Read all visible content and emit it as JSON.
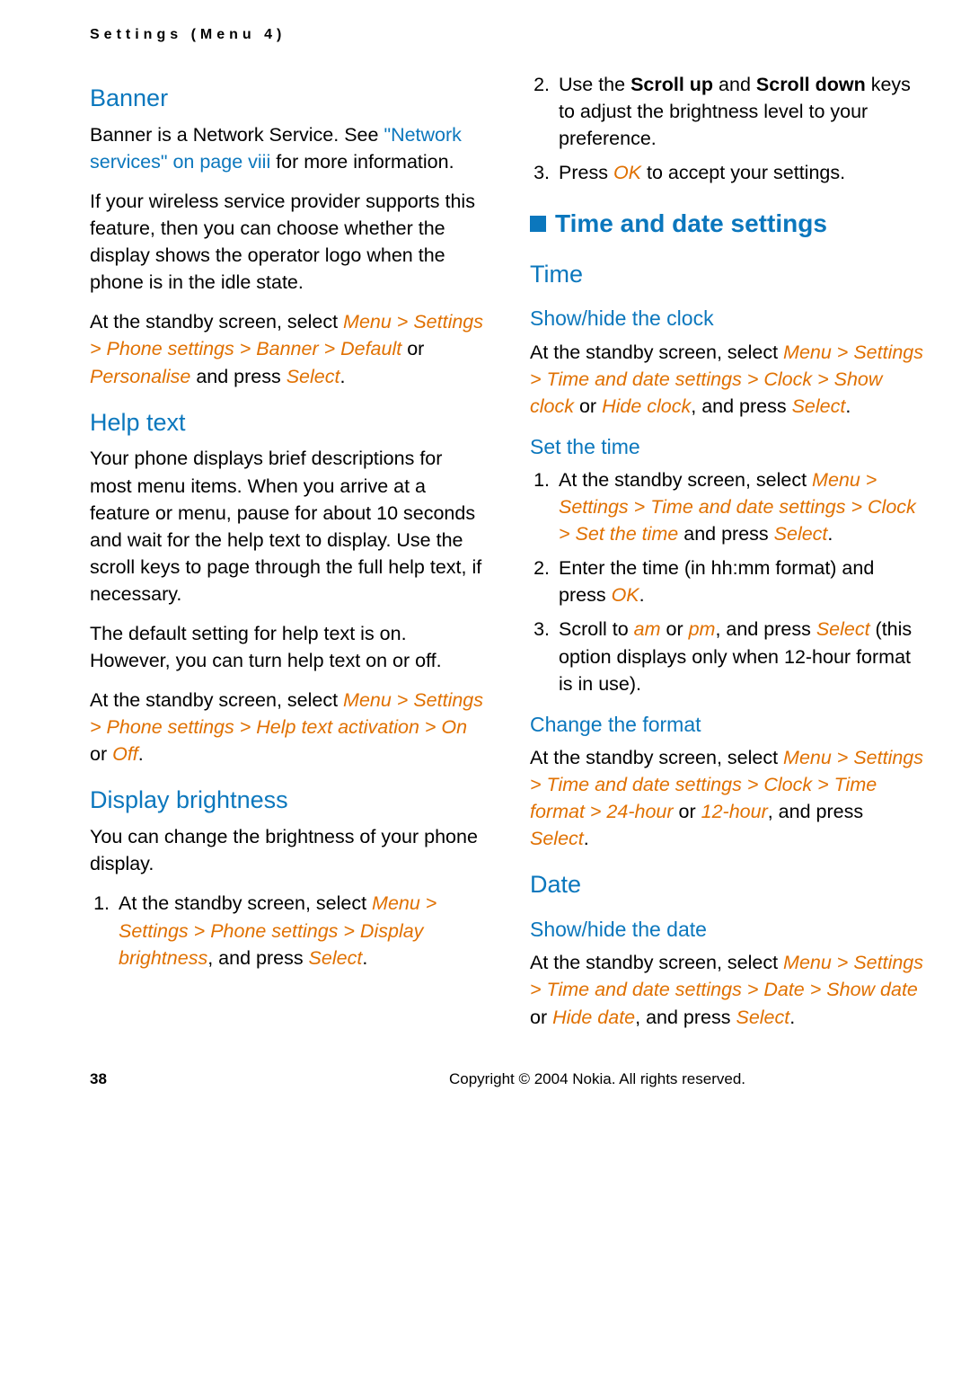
{
  "header": "Settings (Menu 4)",
  "left": {
    "banner": {
      "title": "Banner",
      "p1_a": "Banner is a Network Service. See ",
      "p1_link": "\"Network services\" on page viii",
      "p1_b": " for more information.",
      "p2": "If your wireless service provider supports this feature, then you can choose whether the display shows the operator logo when the phone is in the idle state.",
      "p3_a": "At the standby screen, select ",
      "p3_path": "Menu > Settings > Phone settings > Banner > Default",
      "p3_or": " or ",
      "p3_path2": "Personalise",
      "p3_b": " and press ",
      "p3_sel": "Select",
      "p3_dot": "."
    },
    "help": {
      "title": "Help text",
      "p1": "Your phone displays brief descriptions for most menu items. When you arrive at a feature or menu, pause for about 10 seconds and wait for the help text to display. Use the scroll keys to page through the full help text, if necessary.",
      "p2": "The default setting for help text is on. However, you can turn help text on or off.",
      "p3_a": "At the standby screen, select ",
      "p3_path": "Menu > Settings > Phone settings > Help text activation > On",
      "p3_or": " or ",
      "p3_off": "Off",
      "p3_dot": "."
    },
    "bright": {
      "title": "Display brightness",
      "p1": "You can change the brightness of your phone display.",
      "s1_a": "At the standby screen, select ",
      "s1_path": "Menu > Settings > Phone settings > Display brightness",
      "s1_b": ", and press ",
      "s1_sel": "Select",
      "s1_dot": "."
    }
  },
  "right": {
    "bright_cont": {
      "s2_a": "Use the ",
      "s2_su": "Scroll up",
      "s2_and": " and ",
      "s2_sd": "Scroll down",
      "s2_b": " keys to adjust the brightness level to your preference.",
      "s3_a": "Press ",
      "s3_ok": "OK",
      "s3_b": " to accept your settings."
    },
    "section": "Time and date settings",
    "time": {
      "title": "Time",
      "showhide": {
        "title": "Show/hide the clock",
        "a": "At the standby screen, select ",
        "path": "Menu > Settings > Time and date settings > Clock > Show clock",
        "or": " or ",
        "path2": "Hide clock",
        "b": ", and press ",
        "sel": "Select",
        "dot": "."
      },
      "settime": {
        "title": "Set the time",
        "s1_a": "At the standby screen, select ",
        "s1_path": "Menu > Settings > Time and date settings > Clock > Set the time",
        "s1_b": " and press ",
        "s1_sel": "Select",
        "s1_dot": ".",
        "s2_a": "Enter the time (in hh:mm format) and press ",
        "s2_ok": "OK",
        "s2_dot": ".",
        "s3_a": "Scroll to ",
        "s3_am": "am",
        "s3_or": " or ",
        "s3_pm": "pm",
        "s3_b": ", and press ",
        "s3_sel": "Select",
        "s3_c": " (this option displays only when 12-hour format is in use)."
      },
      "format": {
        "title": "Change the format",
        "a": "At the standby screen, select ",
        "path": "Menu > Settings > Time and date settings > Clock > Time format > 24-hour",
        "or": " or ",
        "path2": "12-hour",
        "b": ", and press ",
        "sel": "Select",
        "dot": "."
      }
    },
    "date": {
      "title": "Date",
      "showhide": {
        "title": "Show/hide the date",
        "a": "At the standby screen, select ",
        "path": "Menu > Settings > Time and date settings > Date > Show date",
        "or": " or ",
        "path2": "Hide date",
        "b": ", and press ",
        "sel": "Select",
        "dot": "."
      }
    }
  },
  "footer": {
    "page": "38",
    "copyright": "Copyright © 2004 Nokia. All rights reserved."
  }
}
